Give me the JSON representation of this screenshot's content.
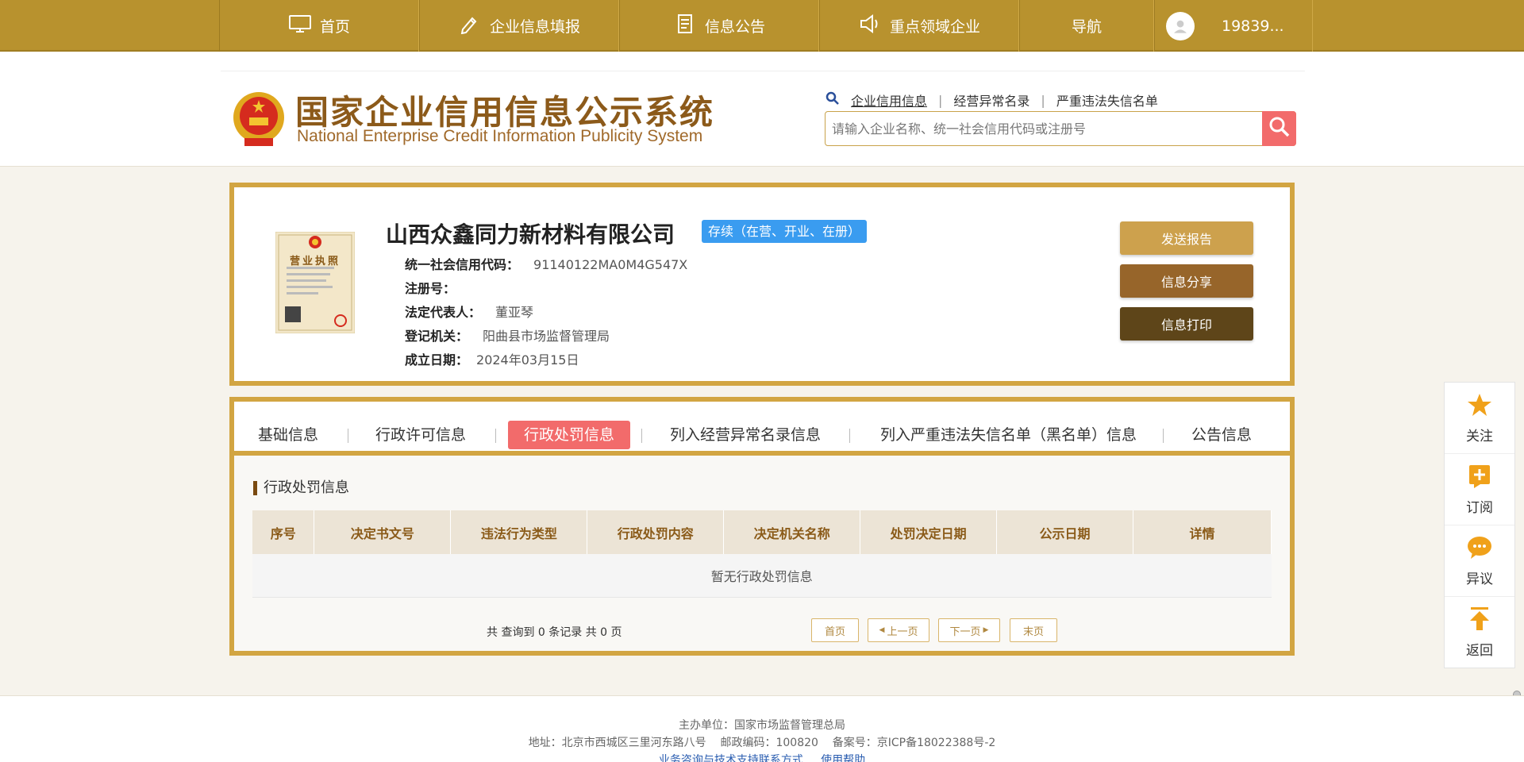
{
  "nav": {
    "home": "首页",
    "fill": "企业信息填报",
    "notice": "信息公告",
    "key": "重点领域企业",
    "guide": "导航",
    "user": "19839..."
  },
  "header": {
    "logo_cn": "国家企业信用信息公示系统",
    "logo_en": "National Enterprise Credit Information Publicity System",
    "search_links": [
      "企业信用信息",
      "经营异常名录",
      "严重违法失信名单"
    ],
    "search_placeholder": "请输入企业名称、统一社会信用代码或注册号"
  },
  "company": {
    "name": "山西众鑫同力新材料有限公司",
    "status": "存续（在营、开业、在册）",
    "license_title": "营业执照",
    "fields": [
      {
        "label": "统一社会信用代码：",
        "value": "91140122MA0M4G547X"
      },
      {
        "label": "注册号：",
        "value": ""
      },
      {
        "label": "法定代表人：",
        "value": "董亚琴"
      },
      {
        "label": "登记机关：",
        "value": "阳曲县市场监督管理局"
      },
      {
        "label": "成立日期：",
        "value": "2024年03月15日"
      }
    ],
    "actions": {
      "send": "发送报告",
      "share": "信息分享",
      "print": "信息打印"
    }
  },
  "tabs": [
    "基础信息",
    "行政许可信息",
    "行政处罚信息",
    "列入经营异常名录信息",
    "列入严重违法失信名单（黑名单）信息",
    "公告信息"
  ],
  "active_tab": "行政处罚信息",
  "section": {
    "title": "行政处罚信息",
    "columns": [
      "序号",
      "决定书文号",
      "违法行为类型",
      "行政处罚内容",
      "决定机关名称",
      "处罚决定日期",
      "公示日期",
      "详情"
    ],
    "empty": "暂无行政处罚信息",
    "pager": {
      "summary": "共 查询到 0 条记录 共 0 页",
      "first": "首页",
      "prev": "上一页",
      "next": "下一页",
      "last": "末页"
    }
  },
  "float": {
    "follow": "关注",
    "subscribe": "订阅",
    "dispute": "异议",
    "back": "返回"
  },
  "footer": {
    "host": "主办单位：国家市场监督管理总局",
    "address": "地址：北京市西城区三里河东路八号    邮政编码：100820    备案号：京ICP备18022388号-2",
    "links": "业务咨询与技术支持联系方式     使用帮助"
  },
  "colors": {
    "gold": "#b8922e",
    "border": "#d2a542",
    "accent": "#f26b6b",
    "badge": "#3a9cf0"
  },
  "icons": [
    "monitor-icon",
    "pen-icon",
    "document-icon",
    "speaker-icon",
    "user-icon",
    "search-icon",
    "star-icon",
    "plus-icon",
    "chat-icon",
    "arrow-up-icon"
  ]
}
